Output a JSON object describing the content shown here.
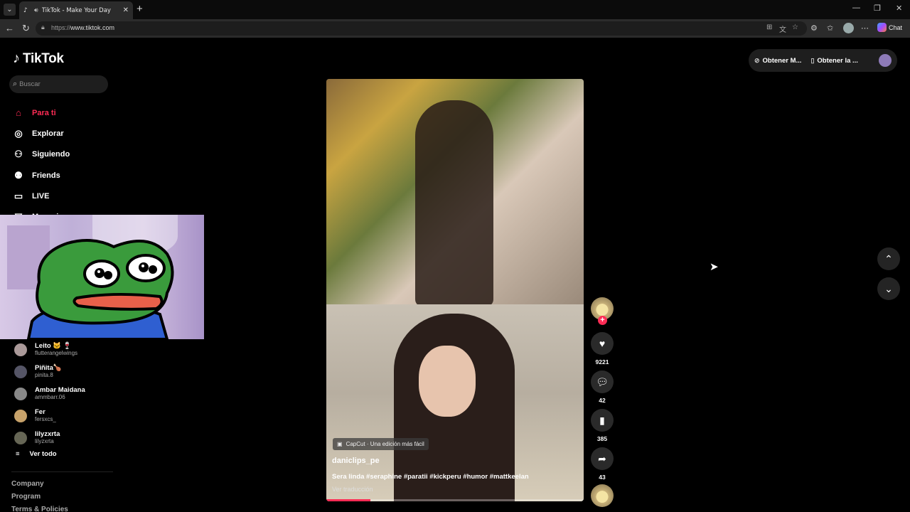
{
  "browser": {
    "tab_title": "TikTok - Make Your Day",
    "url_proto": "https://",
    "url_host": "www.tiktok.com",
    "chat_label": "Chat"
  },
  "app": {
    "logo_text": "TikTok",
    "search_placeholder": "Buscar",
    "menu": [
      {
        "label": "Para ti",
        "icon": "home-icon",
        "active": true
      },
      {
        "label": "Explorar",
        "icon": "compass-icon"
      },
      {
        "label": "Siguiendo",
        "icon": "following-icon"
      },
      {
        "label": "Friends",
        "icon": "friends-icon"
      },
      {
        "label": "LIVE",
        "icon": "live-icon"
      },
      {
        "label": "Mensajes",
        "icon": "messages-icon"
      }
    ],
    "following": [
      {
        "name": "Leito 🐱 🍷",
        "user": "flutterangelwings"
      },
      {
        "name": "Piñita🍗",
        "user": "pinita.8"
      },
      {
        "name": "Ambar Maidana",
        "user": "ammbarr.06"
      },
      {
        "name": "Fer",
        "user": "fersxcs_"
      },
      {
        "name": "lilyzxrta",
        "user": "lilyzxrta"
      }
    ],
    "see_all": "Ver todo",
    "footer": [
      "Company",
      "Program",
      "Terms & Policies"
    ],
    "header_buttons": {
      "coins": "Obtener M...",
      "app": "Obtener la ..."
    }
  },
  "video": {
    "capcut": "CapCut · Una edición más fácil",
    "author": "daniclips_pe",
    "caption": "Sera linda #seraphine #paratii #kickperu #humor #mattkeelan",
    "translate": "Ver traducción",
    "progress": 0.17,
    "likes": "9221",
    "comments": "42",
    "saves": "385",
    "shares": "43"
  },
  "colors": {
    "accent": "#fe2c55",
    "background": "#000000"
  }
}
